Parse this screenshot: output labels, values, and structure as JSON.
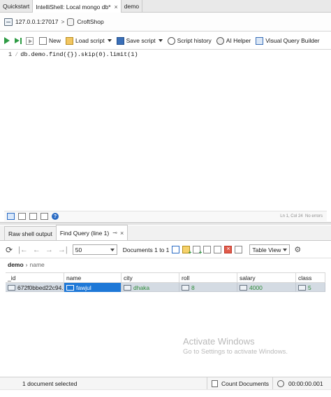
{
  "tabs": [
    {
      "label": "Quickstart",
      "closable": false,
      "active": false
    },
    {
      "label": "IntelliShell: Local mongo db*",
      "closable": true,
      "active": true
    },
    {
      "label": "demo",
      "closable": false,
      "active": false
    }
  ],
  "connection": {
    "server": "127.0.0.1:27017",
    "separator": ">",
    "database": "CroftShop"
  },
  "toolbar": {
    "new_label": "New",
    "load_label": "Load script",
    "save_label": "Save script",
    "history_label": "Script history",
    "ai_label": "AI Helper",
    "vqb_label": "Visual Query Builder"
  },
  "editor": {
    "line_number": "1",
    "code": "db.demo.find({}).skip(0).limit(1)"
  },
  "editor_status": {
    "position": "Ln 1, Col 24",
    "errors": "No errors"
  },
  "result_tabs": [
    {
      "label": "Raw shell output",
      "active": false
    },
    {
      "label": "Find Query (line 1)",
      "active": true
    }
  ],
  "results_toolbar": {
    "page_size": "50",
    "documents_range": "Documents 1 to 1",
    "view_mode": "Table View"
  },
  "breadcrumb": {
    "database": "demo",
    "collection": "name"
  },
  "grid": {
    "columns": [
      "_id",
      "name",
      "city",
      "roll",
      "salary",
      "class"
    ],
    "rows": [
      {
        "_id": "672f0bbed22c94...",
        "name": "fawjul",
        "city": "dhaka",
        "roll": "8",
        "salary": "4000",
        "class": "5"
      }
    ]
  },
  "watermark": {
    "title": "Activate Windows",
    "subtitle": "Go to Settings to activate Windows."
  },
  "status": {
    "selection": "1 document selected",
    "count_label": "Count Documents",
    "elapsed": "00:00:00.001"
  },
  "colors": {
    "accent": "#1e78d7",
    "run_green": "#2e9b44",
    "value_green": "#2e8b3a",
    "row_selected_bg": "#d4dbe3"
  }
}
